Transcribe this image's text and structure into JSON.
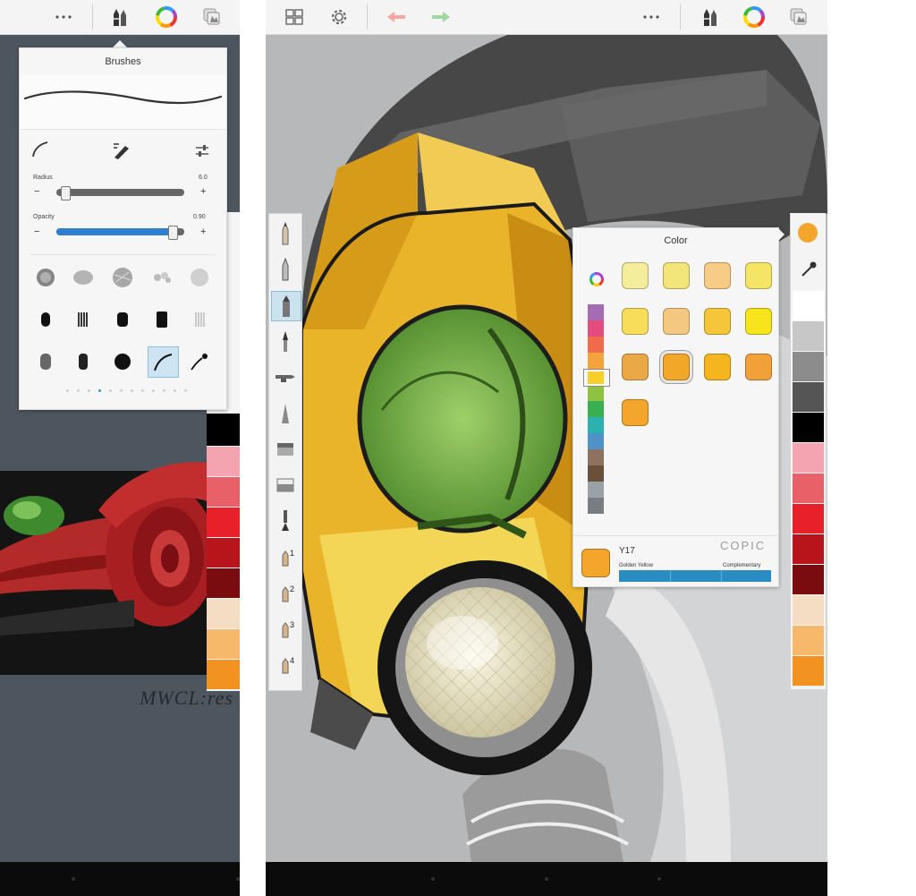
{
  "left": {
    "topbar": {
      "more_icon": "ellipsis-icon",
      "brush_icon": "brush-pens-icon",
      "color_icon": "color-wheel-icon",
      "layers_icon": "layers-icon"
    },
    "brushes": {
      "title": "Brushes",
      "radius_label": "Radius",
      "radius_value": "6.0",
      "radius_fraction": 0.06,
      "opacity_label": "Opacity",
      "opacity_value": "0.90",
      "opacity_fraction": 0.9,
      "minus": "−",
      "plus": "+",
      "page_count": 12,
      "active_page": 3
    },
    "signature": "MWCL:res",
    "swatches": [
      "#f4a4b0",
      "#e86068",
      "#e8202a",
      "#b8141c",
      "#7a0c10",
      "#f4ddc2",
      "#f6b86a",
      "#f29221"
    ]
  },
  "right": {
    "topbar": {
      "grid_icon": "grid-icon",
      "settings_icon": "gear-icon",
      "undo_icon": "undo-arrow-icon",
      "redo_icon": "redo-arrow-icon",
      "more_icon": "ellipsis-icon",
      "brush_icon": "brush-pens-icon",
      "color_icon": "color-wheel-icon",
      "layers_icon": "layers-icon"
    },
    "tools": [
      "pencil-tool",
      "ballpoint-tool",
      "marker-tool",
      "paintbrush-tool",
      "airbrush-tool",
      "smudge-tool",
      "eraser-tool",
      "fill-tool",
      "pen-tool",
      "custom-1",
      "custom-2",
      "custom-3",
      "custom-4"
    ],
    "tool_numbers": [
      "1",
      "2",
      "3",
      "4"
    ],
    "color": {
      "title": "Color",
      "swatches": [
        "#f4ee9c",
        "#f2e57a",
        "#f7cc86",
        "#f5e466",
        "#f7dd5a",
        "#f5c882",
        "#f5c63a",
        "#f7e41c",
        "#eba846",
        "#f2a728",
        "#f5b51e",
        "#f2a03a",
        "#f3a52c"
      ],
      "selected_index": 9,
      "hue_colors": [
        "#a66cb3",
        "#e44c7d",
        "#f26a4c",
        "#f2a33a",
        "#f6d029",
        "#8fc23e",
        "#3cae52",
        "#2ab1b0",
        "#4e92c8",
        "#8d735f",
        "#6a4f3a",
        "#9aa1a7",
        "#777d82"
      ],
      "code": "Y17",
      "name": "Golden Yellow",
      "complementary_label": "Complementary",
      "brand": "COPIC",
      "current": "#f3a52c"
    },
    "swatches": [
      "#ffffff",
      "#c7c7c7",
      "#8c8c8c",
      "#555555",
      "#000000",
      "#f4a4b0",
      "#e86068",
      "#e8202a",
      "#b8141c",
      "#7a0c10",
      "#f4ddc2",
      "#f6b86a",
      "#f29221"
    ]
  }
}
